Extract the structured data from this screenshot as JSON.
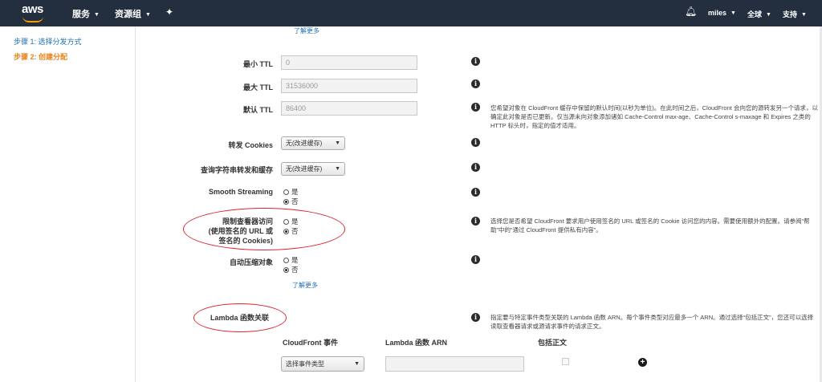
{
  "topbar": {
    "logo": "aws",
    "services": "服务",
    "resource_groups": "资源组",
    "user": "miles",
    "region": "全球",
    "support": "支持"
  },
  "sidebar": {
    "steps": [
      "步骤 1: 选择分发方式",
      "步骤 2: 创建分配"
    ]
  },
  "form": {
    "learn_more": "了解更多",
    "min_ttl": {
      "label": "最小 TTL",
      "value": "0"
    },
    "max_ttl": {
      "label": "最大 TTL",
      "value": "31536000"
    },
    "default_ttl": {
      "label": "默认 TTL",
      "value": "86400",
      "help": "您希望对象在 CloudFront 缓存中保留的默认时间(以秒为单位)。在此时间之后，CloudFront 会向您的源转发另一个请求，以确定此对象是否已更新。仅当源未向对象添加诸如 Cache-Control max-age、Cache-Control s-maxage 和 Expires 之类的 HTTP 标头时，指定的值才适用。"
    },
    "forward_cookies": {
      "label": "转发 Cookies",
      "value": "无(改进缓存)"
    },
    "query_string": {
      "label": "查询字符串转发和缓存",
      "value": "无(改进缓存)"
    },
    "smooth_streaming": {
      "label": "Smooth Streaming",
      "yes": "是",
      "no": "否"
    },
    "restrict_viewer": {
      "label1": "限制查看器访问",
      "label2": "(使用签名的 URL 或",
      "label3": "签名的 Cookies)",
      "yes": "是",
      "no": "否",
      "help": "选择您是否希望 CloudFront 要求用户使用签名的 URL 或签名的 Cookie 访问您的内容。需要使用额外的配置。请参阅“帮助”中的“通过 CloudFront 提供私有内容”。"
    },
    "compress": {
      "label": "自动压缩对象",
      "yes": "是",
      "no": "否"
    },
    "lambda": {
      "label": "Lambda 函数关联",
      "help": "指定要与特定事件类型关联的 Lambda 函数 ARN。每个事件类型对应最多一个 ARN。通过选择“包括正文”，您还可以选择读取查看器请求或源请求事件的请求正文。",
      "col_event": "CloudFront 事件",
      "col_arn": "Lambda 函数 ARN",
      "col_body": "包括正文",
      "event_select": "选择事件类型"
    }
  },
  "colors": {
    "topbar": "#232f3e",
    "accent": "#ff9900",
    "link": "#1f6fb2",
    "annotation": "#d9272e"
  }
}
